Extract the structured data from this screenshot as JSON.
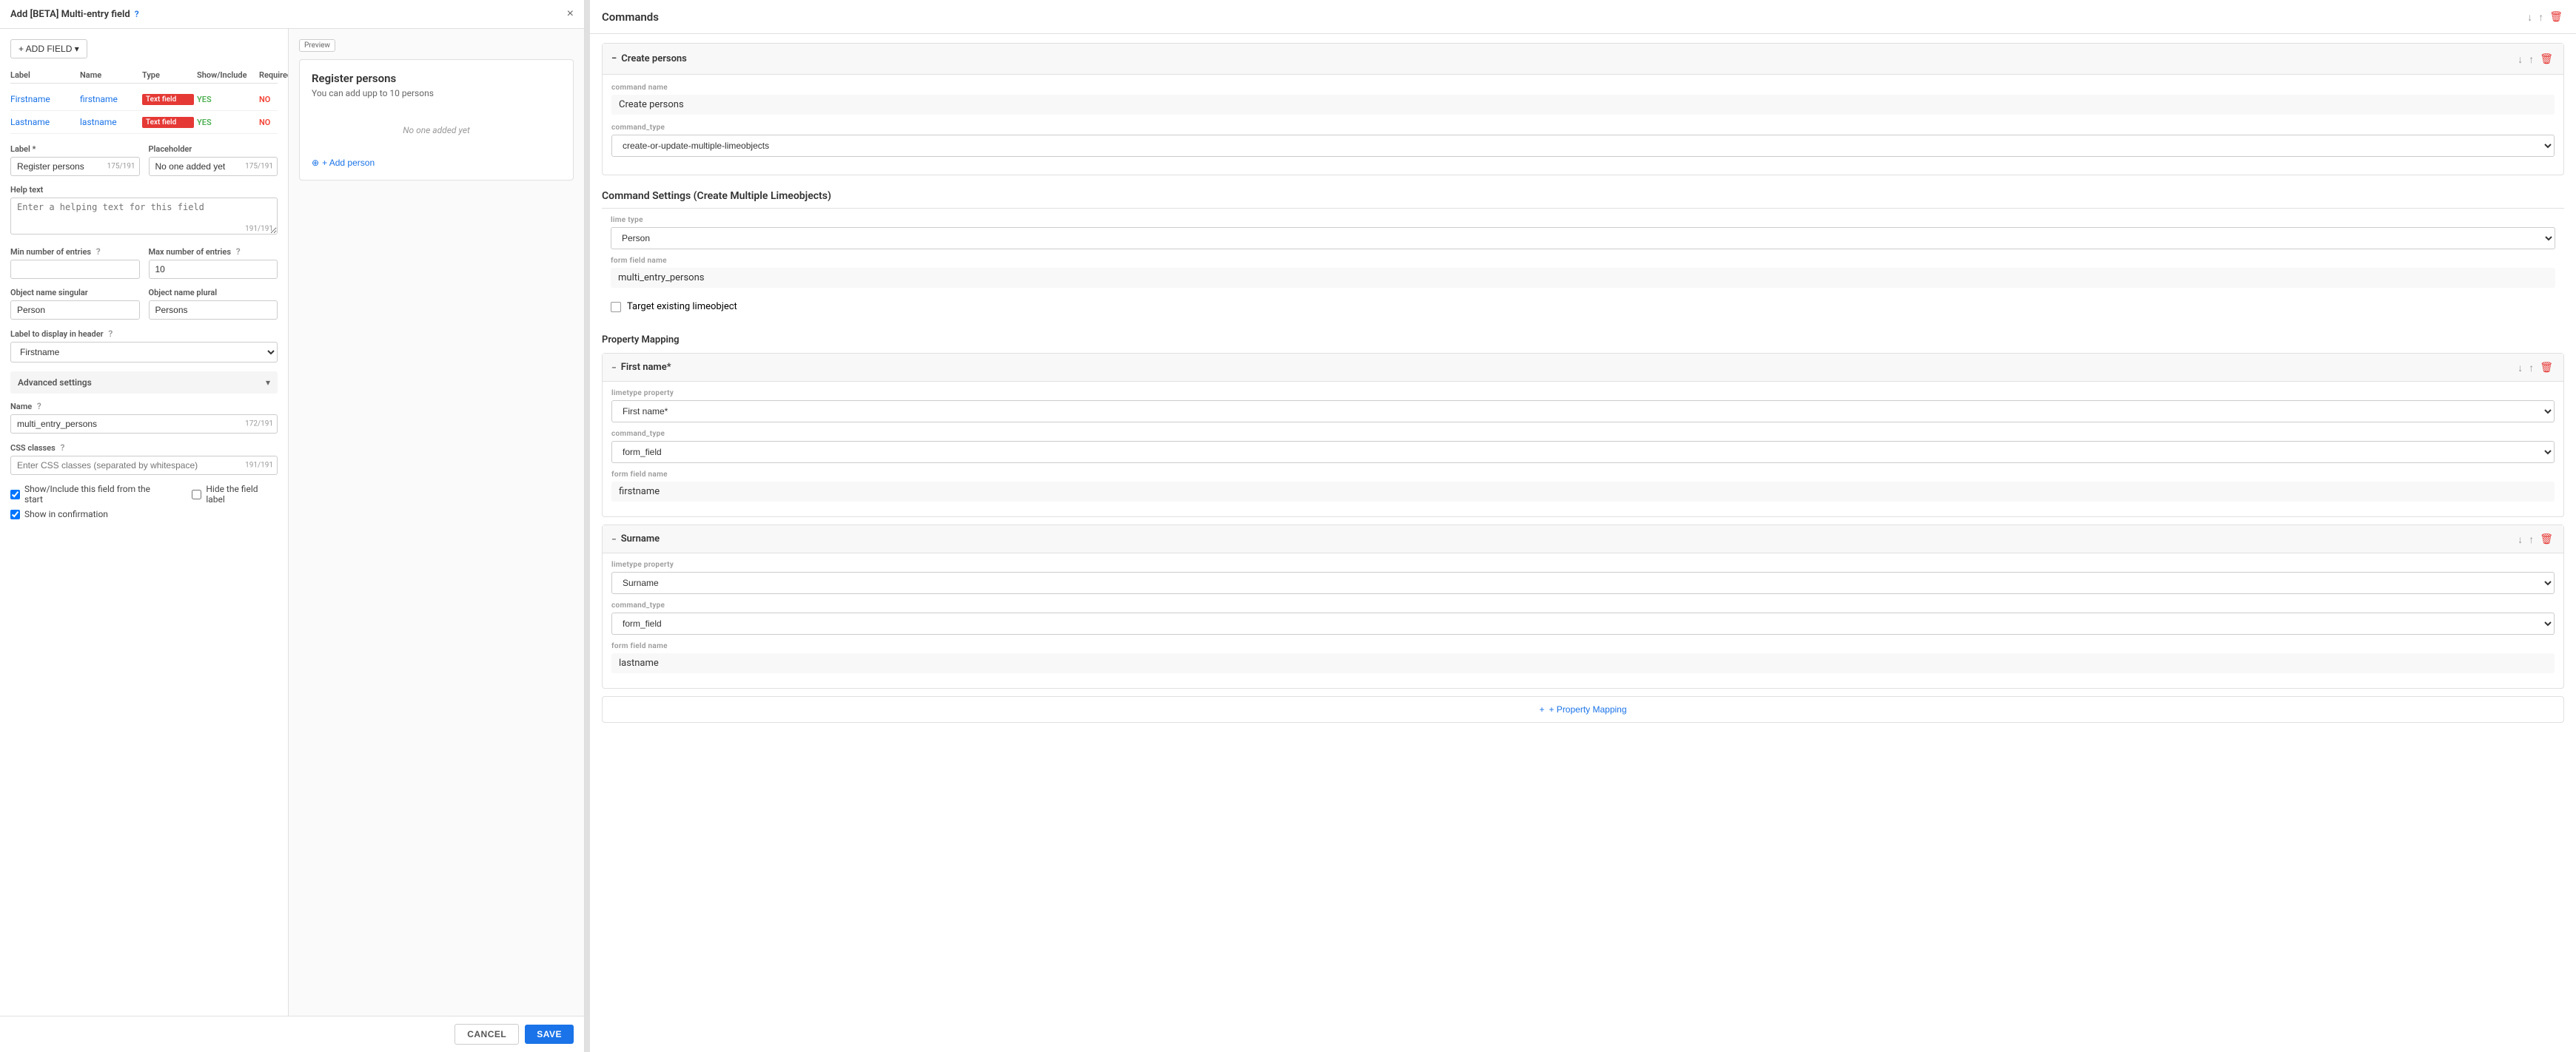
{
  "modal": {
    "title": "Add [BETA] Multi-entry field",
    "help_icon": "?",
    "close_icon": "×"
  },
  "add_field_btn": "+ ADD FIELD ▾",
  "field_table": {
    "headers": [
      "Label",
      "Name",
      "Type",
      "Show/Include",
      "Required",
      ""
    ],
    "rows": [
      {
        "label": "Firstname",
        "name": "firstname",
        "type": "Text field",
        "show": "YES",
        "required": "NO"
      },
      {
        "label": "Lastname",
        "name": "lastname",
        "type": "Text field",
        "show": "YES",
        "required": "NO"
      }
    ]
  },
  "form": {
    "label_label": "Label *",
    "label_value": "Register persons",
    "label_count": "175/191",
    "placeholder_label": "Placeholder",
    "placeholder_value": "No one added yet",
    "placeholder_count": "175/191",
    "help_text_label": "Help text",
    "help_text_value": "",
    "help_text_placeholder": "Enter a helping text for this field",
    "help_text_count": "191/191",
    "min_entries_label": "Min number of entries",
    "max_entries_label": "Max number of entries",
    "max_entries_value": "10",
    "object_singular_label": "Object name singular",
    "object_singular_value": "Person",
    "object_plural_label": "Object name plural",
    "object_plural_value": "Persons",
    "label_display_label": "Label to display in header",
    "label_display_value": "Firstname",
    "advanced_settings_label": "Advanced settings",
    "name_label": "Name",
    "name_value": "multi_entry_persons",
    "name_count": "172/191",
    "css_classes_label": "CSS classes",
    "css_classes_placeholder": "Enter CSS classes (separated by whitespace)",
    "css_classes_count": "191/191",
    "show_include_label": "Show/Include this field from the start",
    "show_confirmation_label": "Show in confirmation",
    "hide_field_label": "Hide the field label"
  },
  "footer": {
    "cancel": "CANCEL",
    "save": "SAVE"
  },
  "preview": {
    "badge": "Preview",
    "title": "Register persons",
    "subtitle": "You can add upp to 10 persons",
    "empty_text": "No one added yet",
    "add_person_label": "+ Add person"
  },
  "commands": {
    "title": "Commands",
    "sections": [
      {
        "id": "create-persons",
        "collapse_icon": "−",
        "title": "Create persons",
        "command_name_label": "Command Name",
        "command_name_value": "Create persons",
        "command_type_label": "command_type",
        "command_type_value": "create-or-update-multiple-limeobjects"
      }
    ],
    "settings_title": "Command Settings (Create Multiple Limeobjects)",
    "lime_type_label": "Lime type",
    "lime_type_value": "Person",
    "form_field_name_label": "Form Field Name",
    "form_field_name_value": "multi_entry_persons",
    "target_existing_label": "Target existing limeobject",
    "property_mapping_title": "Property Mapping",
    "properties": [
      {
        "id": "first-name",
        "collapse_icon": "−",
        "title": "First name*",
        "limetype_property_label": "Limetype property",
        "limetype_property_value": "First name*",
        "command_type_label": "command_type",
        "command_type_value": "form_field",
        "form_field_name_label": "Form field name",
        "form_field_name_value": "firstname"
      },
      {
        "id": "surname",
        "collapse_icon": "−",
        "title": "Surname",
        "limetype_property_label": "Limetype property",
        "limetype_property_value": "Surname",
        "command_type_label": "command_type",
        "command_type_value": "form_field",
        "form_field_name_label": "Form field name",
        "form_field_name_value": "lastname"
      }
    ],
    "add_property_label": "+ Property Mapping"
  }
}
